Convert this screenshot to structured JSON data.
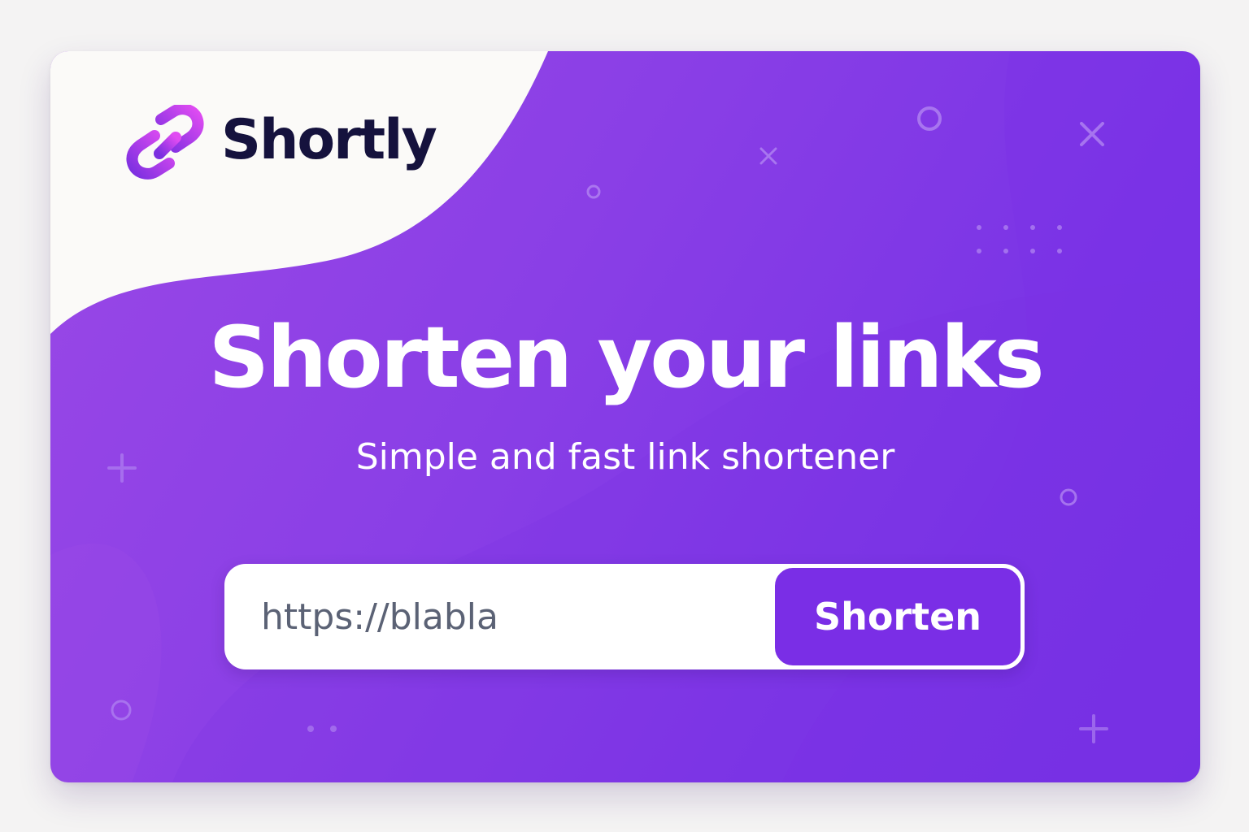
{
  "brand": {
    "name": "Shortly",
    "logo_icon": "link-chain-icon",
    "name_color": "#15123d"
  },
  "hero": {
    "headline": "Shorten your links",
    "subheadline": "Simple and fast link shortener"
  },
  "form": {
    "input_value": "https://blabla",
    "button_label": "Shorten"
  },
  "colors": {
    "accent": "#7a2ee6",
    "background_purple": "#8a3fe6",
    "text_on_accent": "#ffffff",
    "input_text": "#5b6275"
  },
  "decorations": [
    "circle-outline-icon",
    "x-mark-icon",
    "plus-icon",
    "dot-grid-icon"
  ]
}
